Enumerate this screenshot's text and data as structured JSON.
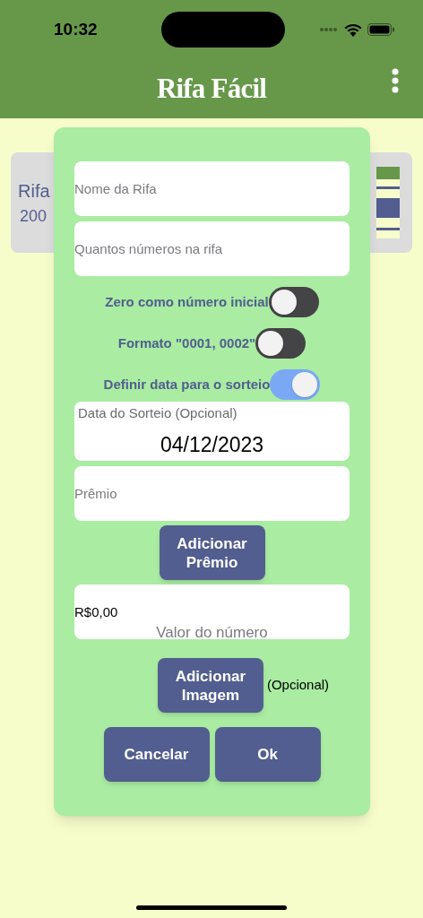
{
  "status_bar": {
    "time": "10:32"
  },
  "header": {
    "title": "Rifa Fácil"
  },
  "background": {
    "card": {
      "title": "Rifa",
      "subtitle": "200"
    }
  },
  "dialog": {
    "name_field": {
      "placeholder": "Nome da Rifa"
    },
    "count_field": {
      "placeholder": "Quantos números na rifa"
    },
    "toggles": [
      {
        "label": "Zero como número inicial",
        "on": false
      },
      {
        "label": "Formato \"0001, 0002\"",
        "on": false
      },
      {
        "label": "Definir data para o sorteio",
        "on": true
      }
    ],
    "date_field": {
      "label": "Data do Sorteio (Opcional)",
      "value": "04/12/2023"
    },
    "prize_field": {
      "placeholder": "Prêmio"
    },
    "add_prize_button": "Adicionar Prêmio",
    "value_field": {
      "value": "R$0,00",
      "label": "Valor do número"
    },
    "add_image_button": "Adicionar Imagem",
    "add_image_note": "(Opcional)",
    "buttons": [
      "Cancelar",
      "Ok"
    ]
  }
}
